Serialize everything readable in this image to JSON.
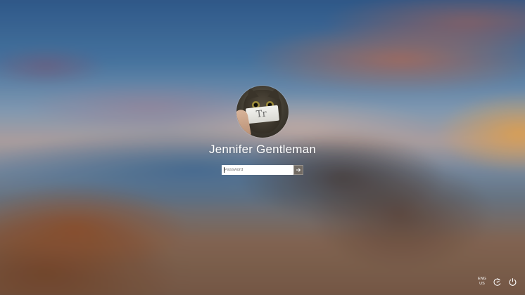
{
  "user": {
    "display_name": "Jennifer Gentleman",
    "avatar_note": "Tr"
  },
  "password_field": {
    "placeholder": "Password",
    "value": ""
  },
  "submit": {
    "icon": "arrow-right-icon"
  },
  "tray": {
    "language_primary": "ENG",
    "language_secondary": "US",
    "ease_of_access_icon": "ease-of-access-icon",
    "power_icon": "power-icon"
  }
}
